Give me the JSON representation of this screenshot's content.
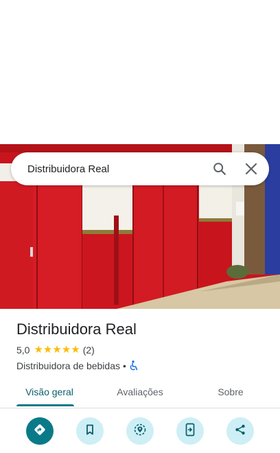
{
  "search": {
    "value": "Distribuidora Real"
  },
  "place": {
    "name": "Distribuidora Real",
    "rating": "5,0",
    "review_count": "(2)",
    "stars": 5,
    "category": "Distribuidora de bebidas",
    "separator": "•"
  },
  "tabs": [
    {
      "label": "Visão geral",
      "active": true
    },
    {
      "label": "Avaliações",
      "active": false
    },
    {
      "label": "Sobre",
      "active": false
    }
  ],
  "actions": [
    {
      "icon": "directions-icon"
    },
    {
      "icon": "bookmark-icon"
    },
    {
      "icon": "nearby-icon"
    },
    {
      "icon": "send-to-phone-icon"
    },
    {
      "icon": "share-icon"
    }
  ],
  "colors": {
    "accent": "#0b7a88",
    "accent_light": "#cdeff5",
    "star": "#fbbc04",
    "wall_red": "#c2121a",
    "accessibility": "#1a73e8"
  }
}
